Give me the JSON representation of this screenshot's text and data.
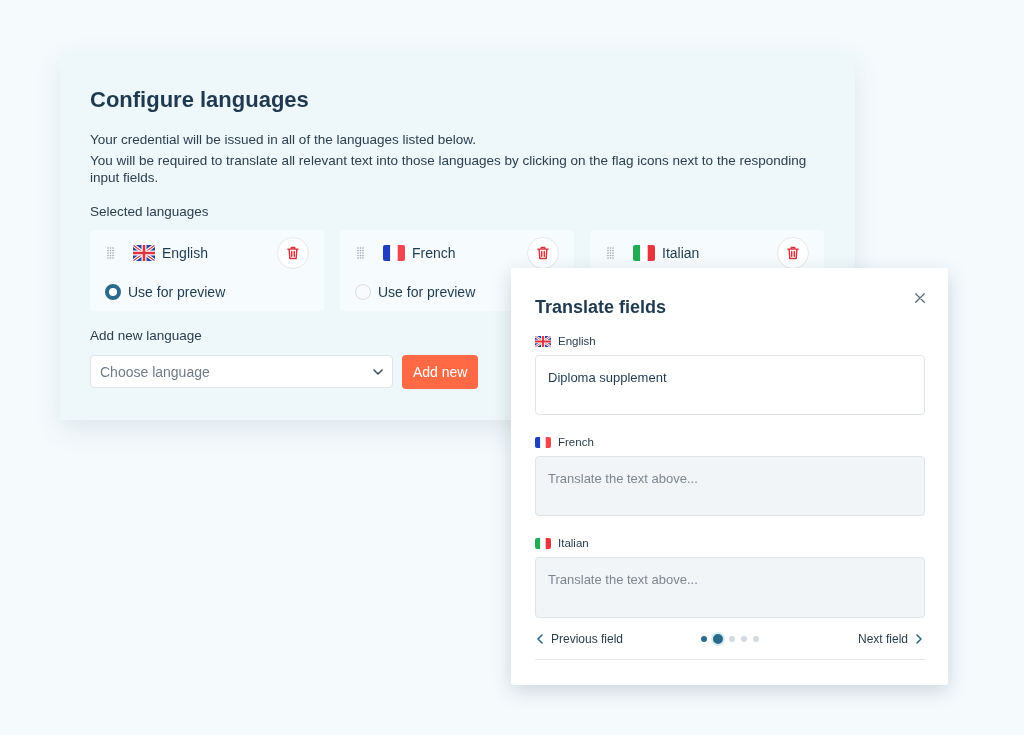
{
  "config": {
    "title": "Configure languages",
    "paragraphs": [
      "Your credential will be issued in all of the languages listed below.",
      "You will be required to translate all relevant text into those languages by clicking on the flag icons next to the responding input fields."
    ],
    "selected_label": "Selected languages",
    "languages": [
      {
        "name": "English",
        "kind": "gb",
        "preview": {
          "label": "Use for preview",
          "selected": true
        }
      },
      {
        "name": "French",
        "kind": "fr",
        "preview": {
          "label": "Use for preview",
          "selected": false
        }
      },
      {
        "name": "Italian",
        "kind": "it"
      }
    ],
    "add_label": "Add new language",
    "language_select": {
      "placeholder": "Choose language"
    },
    "add_button": "Add new"
  },
  "translate_dialog": {
    "title": "Translate fields",
    "fields": [
      {
        "language": "English",
        "kind": "gb",
        "source": true,
        "value": "Diploma supplement"
      },
      {
        "language": "French",
        "kind": "fr",
        "source": false,
        "placeholder": "Translate the text above..."
      },
      {
        "language": "Italian",
        "kind": "it",
        "source": false,
        "placeholder": "Translate the text above..."
      }
    ],
    "previous": "Previous field",
    "next": "Next field",
    "pages": [
      {
        "selected": false,
        "visited": true
      },
      {
        "selected": true,
        "visited": true
      },
      {
        "selected": false,
        "visited": false
      },
      {
        "selected": false,
        "visited": false
      },
      {
        "selected": false,
        "visited": false
      }
    ]
  }
}
